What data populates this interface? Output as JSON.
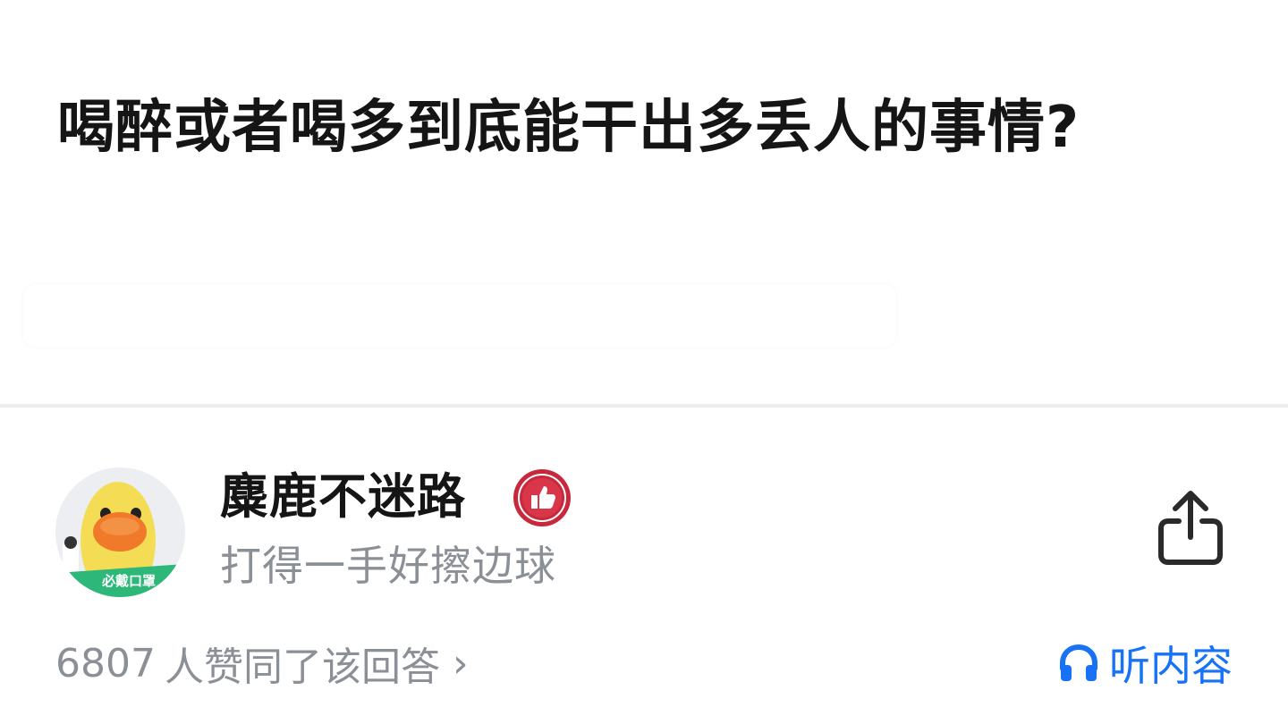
{
  "question": {
    "title": "喝醉或者喝多到底能干出多丢人的事情?"
  },
  "author": {
    "name": "麋鹿不迷路",
    "bio": "打得一手好擦边球",
    "avatar_badge_text": "必戴口罩",
    "avatar_icon": "duck-avatar",
    "badge_icon": "thumbs-up-badge-icon"
  },
  "actions": {
    "share_icon": "share-icon"
  },
  "footer": {
    "vote_count": "6807",
    "vote_text": "人赞同了该回答",
    "vote_chevron": "›",
    "listen_label": "听内容",
    "listen_icon": "headphones-icon"
  },
  "colors": {
    "accent_blue": "#1772f6",
    "muted_gray": "#8b8f96",
    "badge_red": "#c8283c",
    "divider": "#ececec"
  }
}
